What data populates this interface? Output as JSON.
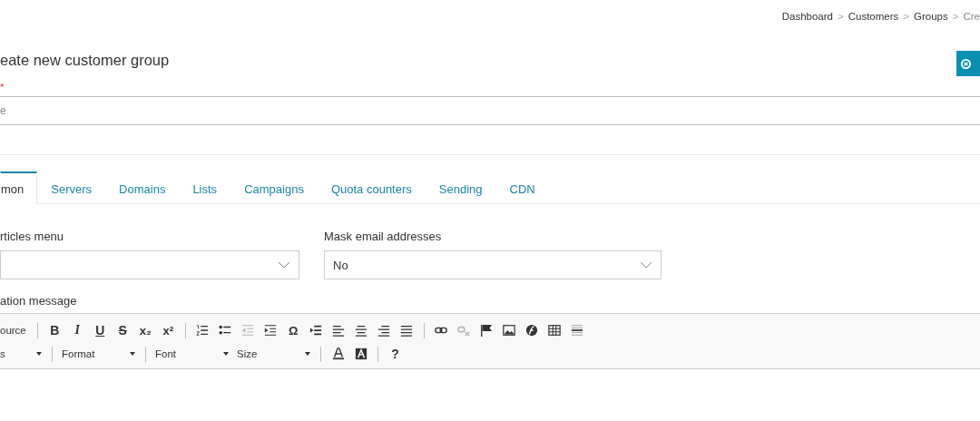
{
  "breadcrumb": {
    "separator": ">",
    "items": [
      {
        "label": "Dashboard",
        "current": false
      },
      {
        "label": "Customers",
        "current": false
      },
      {
        "label": "Groups",
        "current": false
      },
      {
        "label": "Cre",
        "current": true
      }
    ]
  },
  "page_title": "eate new customer group",
  "name_field": {
    "label": "*",
    "required": true,
    "placeholder": "e"
  },
  "tabs": [
    {
      "label": "mon",
      "selected": true
    },
    {
      "label": "Servers",
      "selected": false
    },
    {
      "label": "Domains",
      "selected": false
    },
    {
      "label": "Lists",
      "selected": false
    },
    {
      "label": "Campaigns",
      "selected": false
    },
    {
      "label": "Quota counters",
      "selected": false
    },
    {
      "label": "Sending",
      "selected": false
    },
    {
      "label": "CDN",
      "selected": false
    }
  ],
  "selects": [
    {
      "label": "rticles menu"
    },
    {
      "label": "Mask email addresses",
      "value": "No"
    }
  ],
  "editor": {
    "label": "ation message",
    "toolbar_rows": [
      [
        {
          "kind": "text",
          "label": "ource"
        },
        {
          "kind": "separator"
        },
        {
          "kind": "glyph",
          "label": "B"
        },
        {
          "kind": "glyph",
          "label": "I"
        },
        {
          "kind": "glyph",
          "label": "U"
        },
        {
          "kind": "glyph",
          "label": "S"
        },
        {
          "kind": "glyph",
          "label": "x₂"
        },
        {
          "kind": "glyph",
          "label": "x²"
        },
        {
          "kind": "separator"
        },
        {
          "kind": "icon",
          "disabled": false
        },
        {
          "kind": "icon",
          "disabled": false
        },
        {
          "kind": "icon",
          "disabled": true
        },
        {
          "kind": "icon",
          "disabled": false
        },
        {
          "kind": "glyph",
          "label": "Ω"
        },
        {
          "kind": "icon",
          "disabled": false
        },
        {
          "kind": "icon",
          "disabled": false
        },
        {
          "kind": "icon",
          "disabled": false
        },
        {
          "kind": "icon",
          "disabled": false
        },
        {
          "kind": "icon",
          "disabled": false
        },
        {
          "kind": "separator"
        },
        {
          "kind": "icon",
          "disabled": false
        },
        {
          "kind": "icon",
          "disabled": true
        },
        {
          "kind": "icon",
          "disabled": false
        },
        {
          "kind": "icon",
          "disabled": false
        },
        {
          "kind": "icon",
          "disabled": false
        },
        {
          "kind": "icon",
          "disabled": false
        },
        {
          "kind": "icon",
          "disabled": false
        }
      ],
      [
        {
          "kind": "dropdown",
          "label": "s"
        },
        {
          "kind": "separator"
        },
        {
          "kind": "dropdown",
          "label": "Format"
        },
        {
          "kind": "separator"
        },
        {
          "kind": "dropdown",
          "label": "Font"
        },
        {
          "kind": "dropdown",
          "label": "Size"
        },
        {
          "kind": "separator"
        },
        {
          "kind": "icon",
          "disabled": false
        },
        {
          "kind": "icon",
          "disabled": false
        },
        {
          "kind": "separator"
        },
        {
          "kind": "glyph",
          "label": "?"
        }
      ]
    ]
  }
}
